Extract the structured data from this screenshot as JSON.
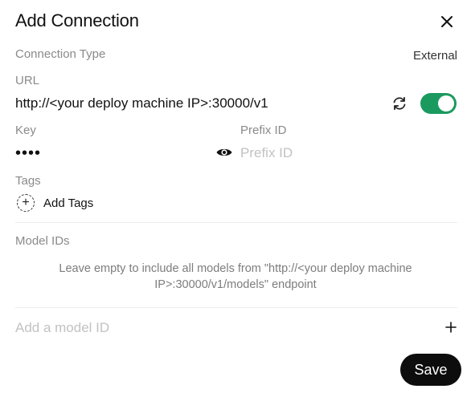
{
  "dialog": {
    "title": "Add Connection",
    "close_icon": "close-icon"
  },
  "connection_type": {
    "label": "Connection Type",
    "value": "External"
  },
  "url": {
    "label": "URL",
    "value": "http://<your deploy machine IP>:30000/v1",
    "refresh_icon": "refresh-icon",
    "enabled": true,
    "toggle_color": "#1b9a5f"
  },
  "key": {
    "label": "Key",
    "value": "••••",
    "visibility_icon": "eye-icon"
  },
  "prefix": {
    "label": "Prefix ID",
    "placeholder": "Prefix ID"
  },
  "tags": {
    "label": "Tags",
    "add_label": "Add Tags",
    "add_icon": "plus-circle-icon"
  },
  "models": {
    "label": "Model IDs",
    "hint": "Leave empty to include all models from \"http://<your deploy machine IP>:30000/v1/models\" endpoint",
    "input_placeholder": "Add a model ID",
    "add_icon": "plus-icon"
  },
  "actions": {
    "save_label": "Save"
  }
}
